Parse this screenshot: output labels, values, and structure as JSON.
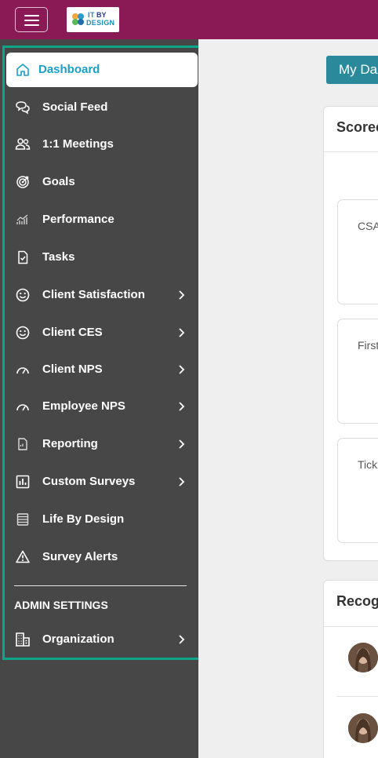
{
  "topbar": {
    "logo": {
      "line1a": "IT",
      "line1b": "BY",
      "line2": "DESIGN"
    }
  },
  "sidebar": {
    "items": [
      {
        "label": "Dashboard",
        "icon": "home-icon",
        "active": true,
        "submenu": false
      },
      {
        "label": "Social Feed",
        "icon": "chat-bubbles-icon",
        "active": false,
        "submenu": false
      },
      {
        "label": "1:1 Meetings",
        "icon": "people-icon",
        "active": false,
        "submenu": false
      },
      {
        "label": "Goals",
        "icon": "target-icon",
        "active": false,
        "submenu": false
      },
      {
        "label": "Performance",
        "icon": "performance-chart-icon",
        "active": false,
        "submenu": false
      },
      {
        "label": "Tasks",
        "icon": "task-document-icon",
        "active": false,
        "submenu": false
      },
      {
        "label": "Client Satisfaction",
        "icon": "smiley-icon",
        "active": false,
        "submenu": true
      },
      {
        "label": "Client CES",
        "icon": "smiley-icon",
        "active": false,
        "submenu": true
      },
      {
        "label": "Client NPS",
        "icon": "gauge-icon",
        "active": false,
        "submenu": true
      },
      {
        "label": "Employee NPS",
        "icon": "gauge-icon",
        "active": false,
        "submenu": true
      },
      {
        "label": "Reporting",
        "icon": "report-icon",
        "active": false,
        "submenu": true
      },
      {
        "label": "Custom Surveys",
        "icon": "bar-chart-icon",
        "active": false,
        "submenu": true
      },
      {
        "label": "Life By Design",
        "icon": "list-icon",
        "active": false,
        "submenu": false
      },
      {
        "label": "Survey Alerts",
        "icon": "warning-icon",
        "active": false,
        "submenu": false
      }
    ],
    "admin_title": "ADMIN SETTINGS",
    "admin_items": [
      {
        "label": "Organization",
        "icon": "building-icon",
        "submenu": true
      }
    ]
  },
  "main": {
    "tab_label": "My Das",
    "scorecard_title": "Scorec",
    "subcards": [
      "CSA",
      "First",
      "Tick"
    ],
    "recognition_title": "Recog"
  },
  "colors": {
    "topbar": "#8a1a56",
    "sidebar": "#474747",
    "active_text": "#1a9fc7",
    "highlight_border": "#0fa58a",
    "tab_button": "#2a8a9c"
  }
}
